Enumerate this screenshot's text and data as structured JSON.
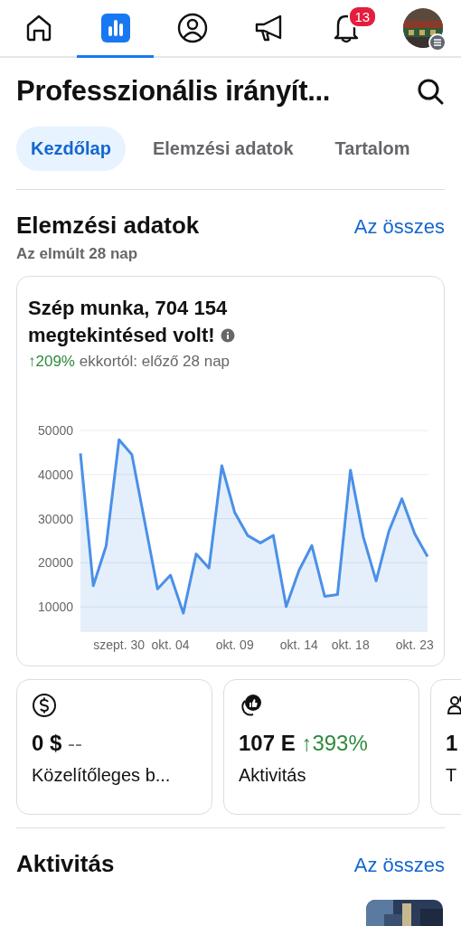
{
  "nav": [
    {
      "kind": "home",
      "selected": false
    },
    {
      "kind": "insights",
      "selected": true
    },
    {
      "kind": "profile",
      "selected": false
    },
    {
      "kind": "megaphone",
      "selected": false
    },
    {
      "kind": "bell",
      "selected": false,
      "badge": "13"
    },
    {
      "kind": "avatar",
      "selected": false
    }
  ],
  "header": {
    "title": "Professzionális irányít..."
  },
  "tabs": [
    {
      "label": "Kezdőlap",
      "selected": true
    },
    {
      "label": "Elemzési adatok",
      "selected": false
    },
    {
      "label": "Tartalom",
      "selected": false
    }
  ],
  "insights": {
    "title": "Elemzési adatok",
    "link": "Az összes",
    "subtitle": "Az elmúlt 28 nap",
    "card": {
      "headline": "Szép munka, 704 154 megtekintésed volt!",
      "change": "↑209%",
      "comparison": "ekkortól: előző 28 nap",
      "chart_data": {
        "type": "area",
        "categories": [
          null,
          null,
          null,
          "szept. 30",
          null,
          null,
          null,
          "okt. 04",
          null,
          null,
          null,
          null,
          "okt. 09",
          null,
          null,
          null,
          null,
          "okt. 14",
          null,
          null,
          null,
          "okt. 18",
          null,
          null,
          null,
          null,
          "okt. 23",
          null
        ],
        "series": [
          {
            "color": "#4a90e8",
            "values": [
              44800,
              14800,
              23800,
              47900,
              44500,
              29300,
              14100,
              17200,
              8600,
              22000,
              18800,
              42000,
              31400,
              26200,
              24500,
              26200,
              10100,
              18300,
              23900,
              12400,
              12800,
              41000,
              25900,
              15900,
              27200,
              34500,
              26600,
              21400
            ]
          }
        ],
        "ylim": [
          4500,
          50000
        ],
        "yticks": [
          10000,
          20000,
          30000,
          40000,
          50000
        ],
        "grid": true
      }
    }
  },
  "metrics": [
    {
      "kind": "dollar",
      "value": "0 $",
      "change": "--",
      "positive": false,
      "label": "Közelítőleges b..."
    },
    {
      "kind": "engagement",
      "value": "107 E",
      "change": "↑393%",
      "positive": true,
      "label": "Aktivitás"
    },
    {
      "kind": "people",
      "value": "1",
      "label": "T"
    }
  ],
  "activity": {
    "title": "Aktivitás",
    "link": "Az összes"
  }
}
